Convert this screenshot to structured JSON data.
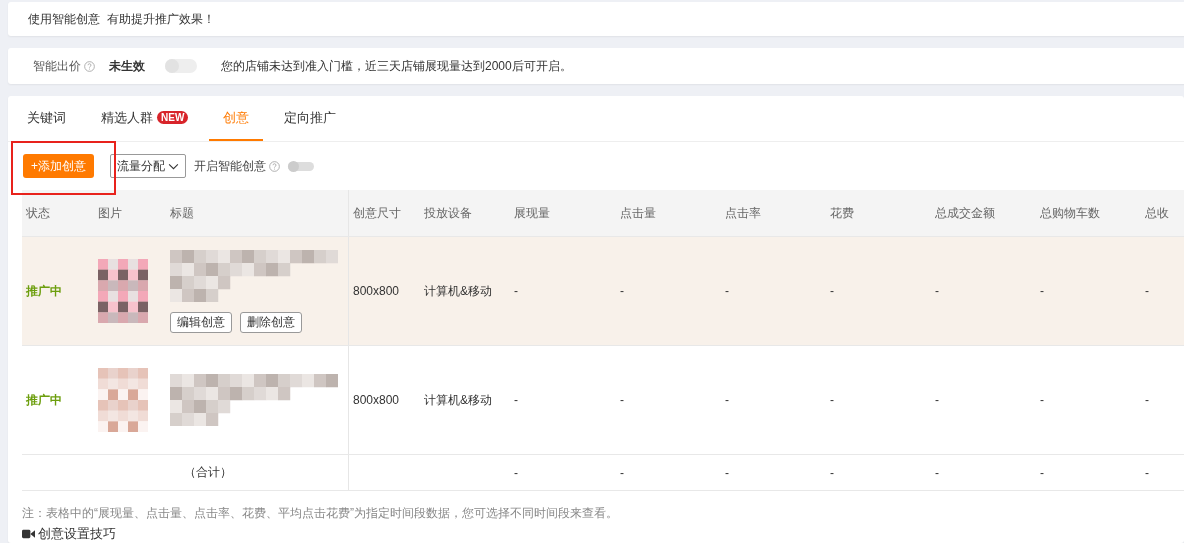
{
  "notice": {
    "text": "使用智能创意  有助提升推广效果！"
  },
  "smart_bid": {
    "label": "智能出价",
    "status": "未生效",
    "on": false,
    "message": "您的店铺未达到准入门槛，近三天店铺展现量达到2000后可开启。"
  },
  "tabs": [
    {
      "label": "关键词",
      "selected": false
    },
    {
      "label": "精选人群",
      "badge": "NEW",
      "selected": false
    },
    {
      "label": "创意",
      "selected": true
    },
    {
      "label": "定向推广",
      "selected": false
    }
  ],
  "toolbar": {
    "add_button": "+添加创意",
    "highlighted": true,
    "dropdown": "流量分配",
    "smart_creative": {
      "label": "开启智能创意",
      "on": false
    }
  },
  "table": {
    "columns": [
      "状态",
      "图片",
      "标题",
      "创意尺寸",
      "投放设备",
      "展现量",
      "点击量",
      "点击率",
      "花费",
      "总成交金额",
      "总购物车数",
      "总收"
    ],
    "rows": [
      {
        "status": "推广中",
        "size": "800x800",
        "device": "计算机&移动",
        "metrics": [
          "-",
          "-",
          "-",
          "-",
          "-",
          "-",
          "-"
        ],
        "hovered": true,
        "actions": [
          "编辑创意",
          "删除创意"
        ]
      },
      {
        "status": "推广中",
        "size": "800x800",
        "device": "计算机&移动",
        "metrics": [
          "-",
          "-",
          "-",
          "-",
          "-",
          "-",
          "-"
        ],
        "hovered": false
      }
    ],
    "total": {
      "label": "（合计）",
      "metrics": [
        "-",
        "-",
        "-",
        "-",
        "-",
        "-",
        "-"
      ]
    }
  },
  "note": "注：表格中的“展现量、点击量、点击率、花费、平均点击花费”为指定时间段数据，您可选择不同时间段来查看。",
  "tips_link": "创意设置技巧"
}
